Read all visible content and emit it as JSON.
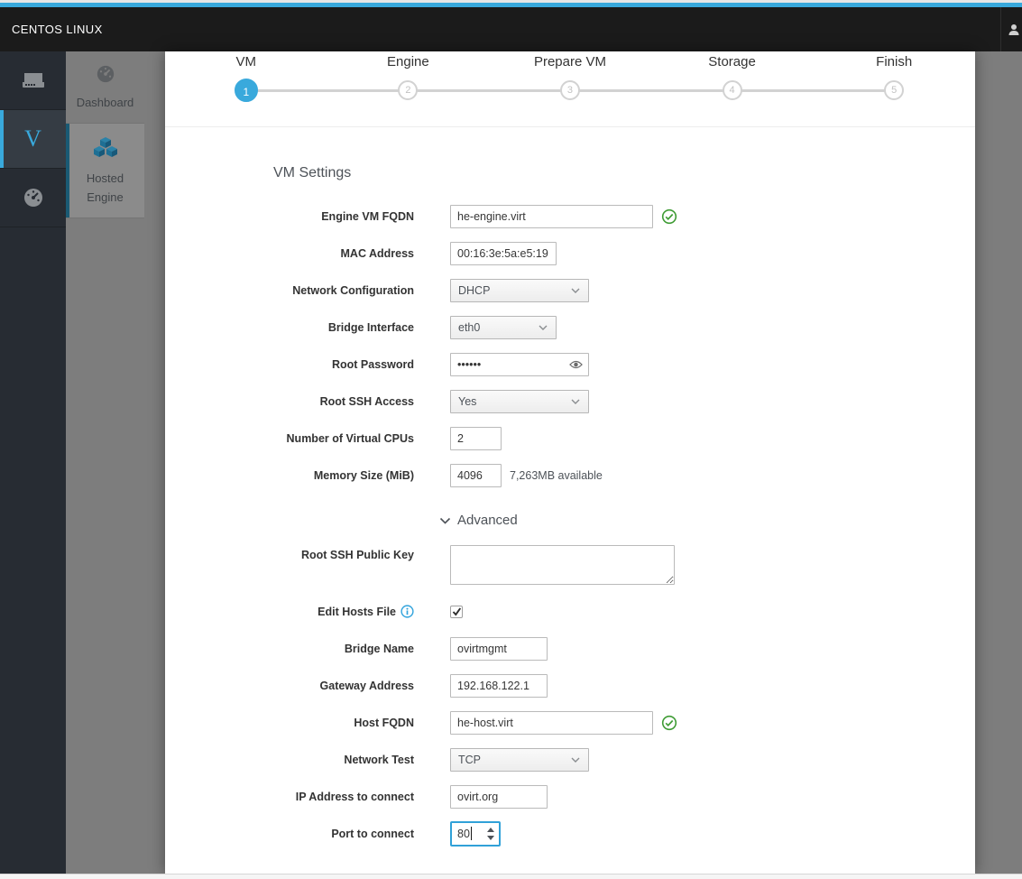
{
  "topbar": {
    "brand": "CENTOS LINUX"
  },
  "sidebar": {
    "primary": [
      {
        "icon": "server-icon"
      },
      {
        "icon": "vm-plugin-letter",
        "label": "V",
        "active": true
      },
      {
        "icon": "dashboard-icon"
      }
    ],
    "secondary": [
      {
        "icon": "dashboard-icon",
        "label": "Dashboard"
      },
      {
        "icon": "cubes-icon",
        "label_line1": "Hosted",
        "label_line2": "Engine",
        "active": true
      }
    ]
  },
  "wizard": {
    "steps": [
      {
        "label": "VM",
        "number": "1",
        "active": true
      },
      {
        "label": "Engine",
        "number": "2"
      },
      {
        "label": "Prepare VM",
        "number": "3"
      },
      {
        "label": "Storage",
        "number": "4"
      },
      {
        "label": "Finish",
        "number": "5"
      }
    ]
  },
  "form": {
    "section_title": "VM Settings",
    "advanced_title": "Advanced",
    "fields": {
      "engine_vm_fqdn": {
        "label": "Engine VM FQDN",
        "value": "he-engine.virt"
      },
      "mac_address": {
        "label": "MAC Address",
        "value": "00:16:3e:5a:e5:19"
      },
      "network_configuration": {
        "label": "Network Configuration",
        "value": "DHCP"
      },
      "bridge_interface": {
        "label": "Bridge Interface",
        "value": "eth0"
      },
      "root_password": {
        "label": "Root Password",
        "value": "••••••"
      },
      "root_ssh_access": {
        "label": "Root SSH Access",
        "value": "Yes"
      },
      "num_cpus": {
        "label": "Number of Virtual CPUs",
        "value": "2"
      },
      "memory_size": {
        "label": "Memory Size (MiB)",
        "value": "4096",
        "note": "7,263MB available"
      },
      "root_ssh_public_key": {
        "label": "Root SSH Public Key",
        "value": ""
      },
      "edit_hosts_file": {
        "label": "Edit Hosts File",
        "checked": true
      },
      "bridge_name": {
        "label": "Bridge Name",
        "value": "ovirtmgmt"
      },
      "gateway_address": {
        "label": "Gateway Address",
        "value": "192.168.122.1"
      },
      "host_fqdn": {
        "label": "Host FQDN",
        "value": "he-host.virt"
      },
      "network_test": {
        "label": "Network Test",
        "value": "TCP"
      },
      "ip_address": {
        "label": "IP Address to connect",
        "value": "ovirt.org"
      },
      "port": {
        "label": "Port to connect",
        "value": "80"
      }
    }
  },
  "colors": {
    "accent_blue": "#39a9dc",
    "topbar": "#1b1b1b",
    "valid_green": "#3f9c35",
    "overlay_gray": "#7d7d7d"
  }
}
